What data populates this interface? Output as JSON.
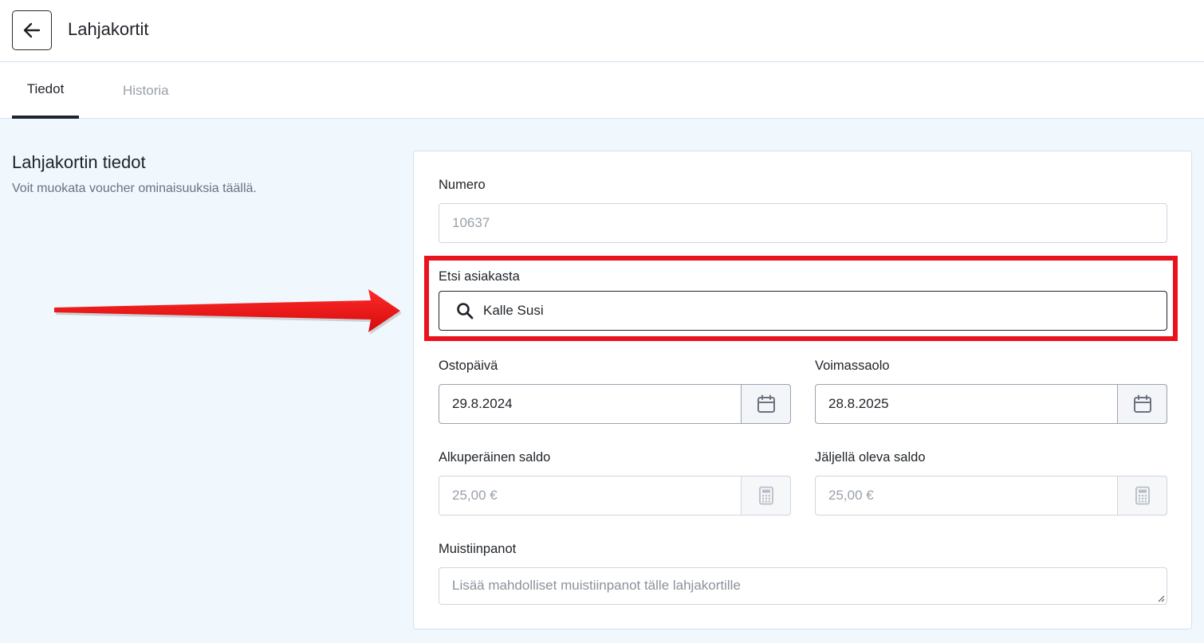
{
  "header": {
    "title": "Lahjakortit",
    "back_icon": "arrow-left-icon"
  },
  "tabs": [
    {
      "label": "Tiedot",
      "active": true
    },
    {
      "label": "Historia",
      "active": false
    }
  ],
  "section": {
    "title": "Lahjakortin tiedot",
    "description": "Voit muokata voucher ominaisuuksia täällä."
  },
  "form": {
    "number": {
      "label": "Numero",
      "value": "10637"
    },
    "customer": {
      "label": "Etsi asiakasta",
      "value": "Kalle Susi",
      "icon": "search-icon"
    },
    "purchase_date": {
      "label": "Ostopäivä",
      "value": "29.8.2024",
      "icon": "calendar-icon"
    },
    "valid_until": {
      "label": "Voimassaolo",
      "value": "28.8.2025",
      "icon": "calendar-icon"
    },
    "original_balance": {
      "label": "Alkuperäinen saldo",
      "value": "25,00 €",
      "icon": "calculator-icon"
    },
    "remaining_balance": {
      "label": "Jäljellä oleva saldo",
      "value": "25,00 €",
      "icon": "calculator-icon"
    },
    "notes": {
      "label": "Muistiinpanot",
      "placeholder": "Lisää mahdolliset muistiinpanot tälle lahjakortille"
    }
  },
  "colors": {
    "highlight": "#e8131c",
    "accent": "#1f2430",
    "background": "#f0f7fd"
  }
}
